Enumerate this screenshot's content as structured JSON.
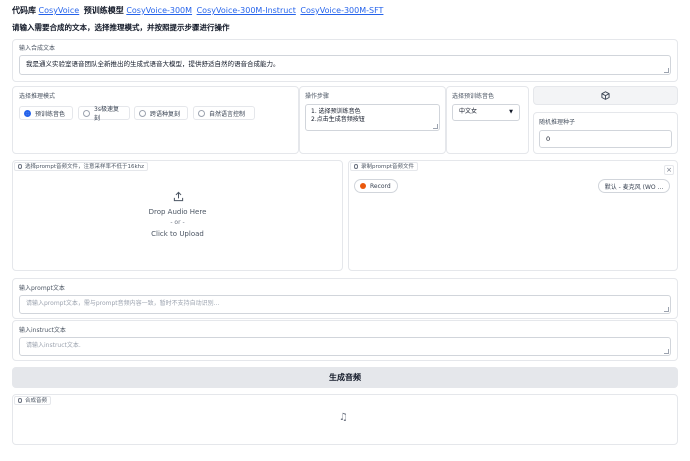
{
  "header": {
    "prefix": "代码库",
    "repo_link": "CosyVoice",
    "models_label": "预训练模型",
    "model_links": [
      "CosyVoice-300M",
      "CosyVoice-300M-Instruct",
      "CosyVoice-300M-SFT"
    ]
  },
  "subheader": "请输入需要合成的文本，选择推理模式，并按照提示步骤进行操作",
  "tts_text": {
    "label": "输入合成文本",
    "value": "我是通义实验室语音团队全新推出的生成式语音大模型，提供舒适自然的语音合成能力。"
  },
  "mode": {
    "label": "选择推理模式",
    "options": [
      "预训练音色",
      "3s极速复刻",
      "跨语种复刻",
      "自然语言控制"
    ],
    "selected_index": 0
  },
  "steps": {
    "label": "操作步骤",
    "lines": [
      "1. 选择预训练音色",
      "2.点击生成音频按钮"
    ]
  },
  "speaker": {
    "label": "选择预训练音色",
    "value": "中文女"
  },
  "seed": {
    "button_icon": "dice-icon",
    "label": "随机推理种子",
    "value": "0"
  },
  "upload": {
    "tag": "选择prompt音频文件，注意采样率不低于16khz",
    "drop_text": "Drop Audio Here",
    "or_text": "- or -",
    "click_text": "Click to Upload"
  },
  "record": {
    "tag": "录制prompt音频文件",
    "button": "Record",
    "device": "默认 - 麦克风 (WO ..."
  },
  "prompt_text": {
    "label": "输入prompt文本",
    "placeholder": "请输入prompt文本，需与prompt音频内容一致，暂时不支持自动识别..."
  },
  "instruct_text": {
    "label": "输入instruct文本",
    "placeholder": "请输入instruct文本."
  },
  "generate_button": "生成音频",
  "output": {
    "tag": "合成音频",
    "icon": "music-note-icon"
  },
  "colors": {
    "link": "#2563eb",
    "record_dot": "#ea580c",
    "radio_active": "#2563eb"
  }
}
